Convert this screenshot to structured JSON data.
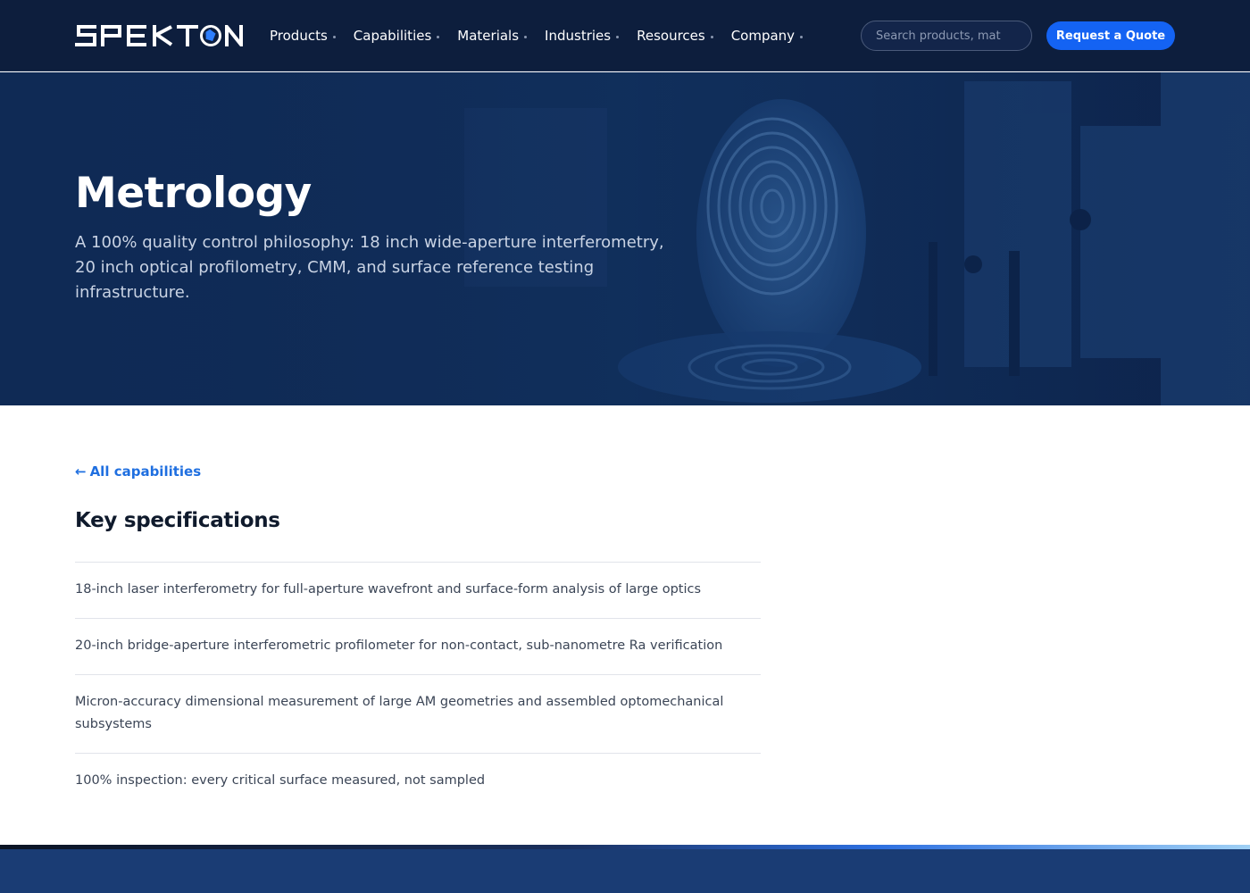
{
  "nav": {
    "logo_text": "SPEKTON",
    "menu": [
      {
        "label": "Products"
      },
      {
        "label": "Capabilities"
      },
      {
        "label": "Materials"
      },
      {
        "label": "Industries"
      },
      {
        "label": "Resources"
      },
      {
        "label": "Company"
      }
    ],
    "search_placeholder": "Search products, mat",
    "quote_button": "Request a Quote"
  },
  "hero": {
    "title": "Metrology",
    "subtitle": "A 100% quality control philosophy: 18 inch wide-aperture interferometry, 20 inch optical profilometry, CMM, and surface reference testing infrastructure."
  },
  "content": {
    "back_link": "All capabilities",
    "section_title": "Key specifications",
    "specs": [
      "18-inch laser interferometry for full-aperture wavefront and surface-form analysis of large optics",
      "20-inch bridge-aperture interferometric profilometer for non-contact, sub-nanometre Ra verification",
      "Micron-accuracy dimensional measurement of large AM geometries and assembled optomechanical subsystems",
      "100% inspection: every critical surface measured, not sampled"
    ]
  },
  "colors": {
    "nav_bg": "#0d1e3d",
    "accent": "#1463f3",
    "link": "#1f6fe0",
    "footer_bg": "#1a3c74"
  }
}
